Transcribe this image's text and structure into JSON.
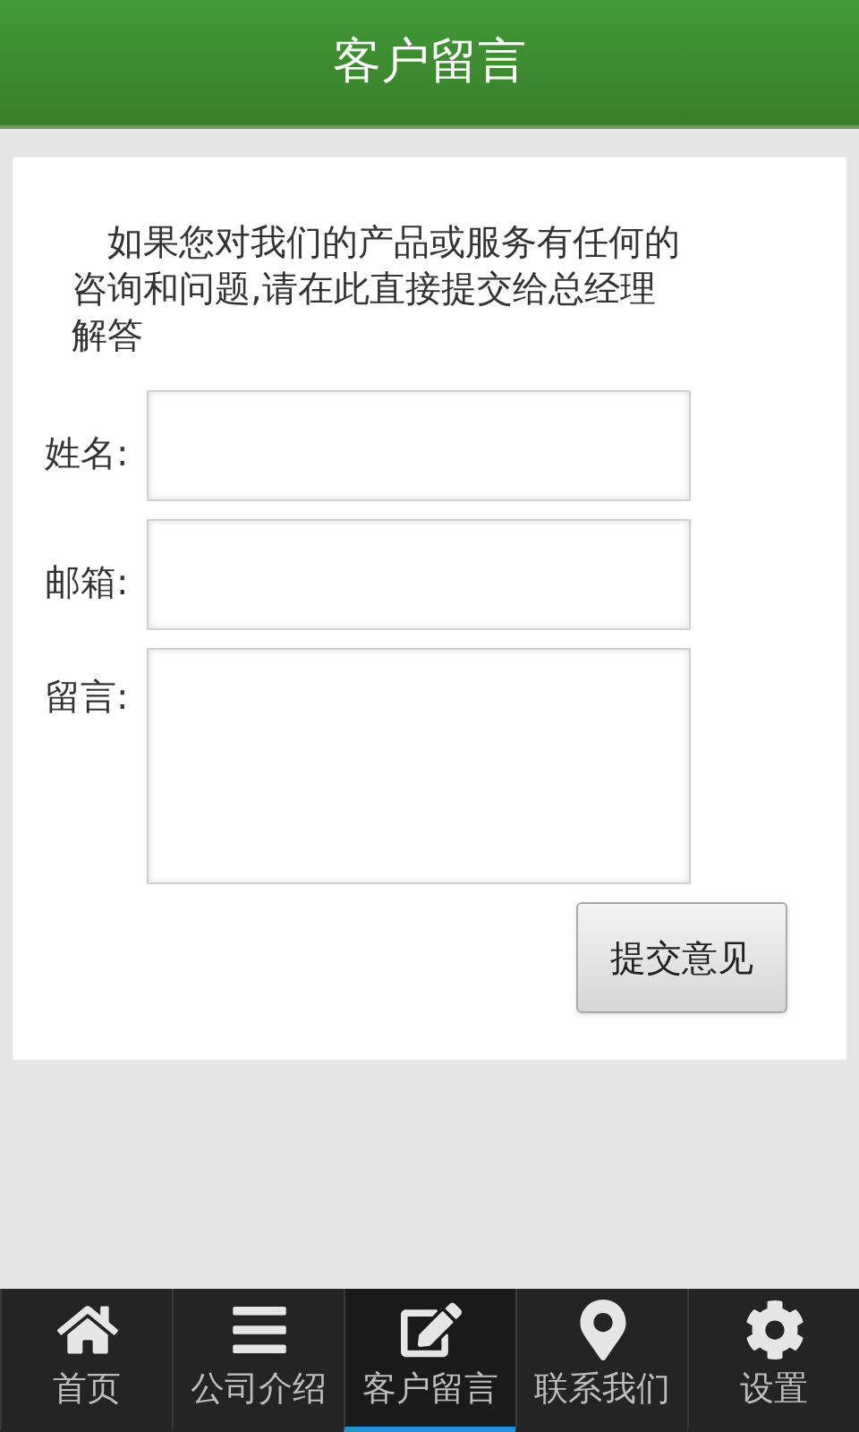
{
  "header": {
    "title": "客户留言"
  },
  "form": {
    "intro": "如果您对我们的产品或服务有任何的咨询和问题,请在此直接提交给总经理解答",
    "fields": [
      {
        "label": "姓名:",
        "kind": "line"
      },
      {
        "label": "邮箱:",
        "kind": "line"
      },
      {
        "label": "留言:",
        "kind": "area"
      }
    ],
    "submit": "提交意见"
  },
  "tabs": [
    {
      "label": "首页",
      "kind": "home",
      "selected": false
    },
    {
      "label": "公司介绍",
      "kind": "list",
      "selected": false
    },
    {
      "label": "客户留言",
      "kind": "edit",
      "selected": true
    },
    {
      "label": "联系我们",
      "kind": "pin",
      "selected": false
    },
    {
      "label": "设置",
      "kind": "gear",
      "selected": false
    }
  ]
}
